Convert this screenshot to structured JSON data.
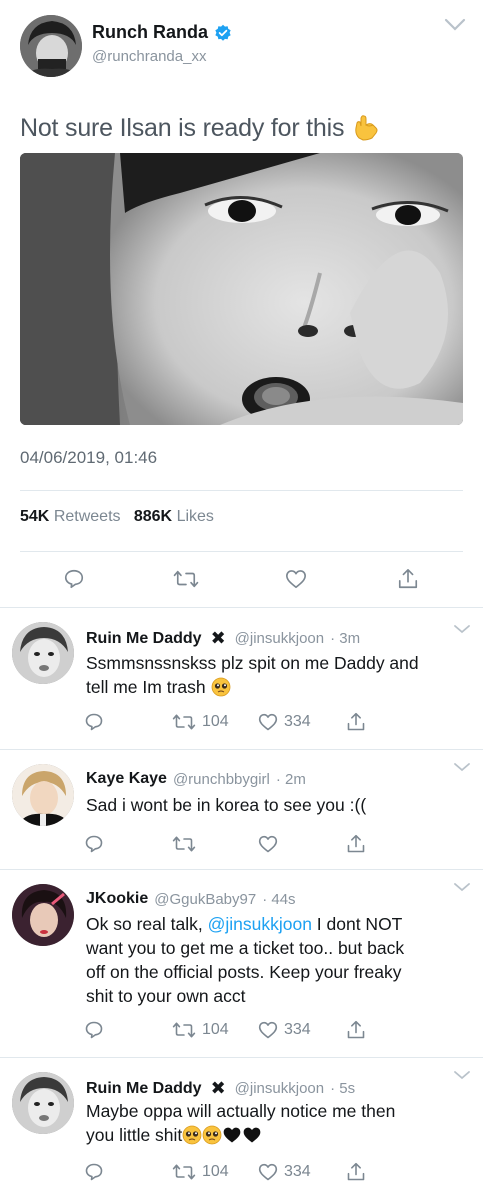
{
  "main_tweet": {
    "author_name": "Runch Randa",
    "handle": "@runchranda_xx",
    "verified": true,
    "text": "Not sure Ilsan is ready for this",
    "text_emoji": "hand-sign-emoji",
    "timestamp": "04/06/2019, 01:46",
    "retweets_count": "54K",
    "retweets_label": "Retweets",
    "likes_count": "886K",
    "likes_label": "Likes"
  },
  "replies": [
    {
      "name": "Ruin Me Daddy",
      "name_suffix": "✖",
      "handle": "@jinsukkjoon",
      "time": "· 3m",
      "text_line1": "Ssmmsnssnskss plz spit on me Daddy and",
      "text_line2": "tell me Im trash",
      "emojis": [
        "pleading-face-emoji"
      ],
      "retweets": "104",
      "likes": "334"
    },
    {
      "name": "Kaye Kaye",
      "handle": "@runchbbygirl",
      "time": "· 2m",
      "text": "Sad i wont be in korea to see you :((",
      "retweets": "",
      "likes": ""
    },
    {
      "name": "JKookie",
      "handle": "@GgukBaby97",
      "time": "· 44s",
      "text_line1_pre": "Ok so real talk, ",
      "mention": "@jinsukkjoon",
      "text_line1_post": " I dont NOT",
      "text_line2": "want you to get me a ticket too.. but back",
      "text_line3": "off on the official posts. Keep your freaky",
      "text_line4": "shit to your own acct",
      "retweets": "104",
      "likes": "334"
    },
    {
      "name": "Ruin Me Daddy",
      "name_suffix": "✖",
      "handle": "@jinsukkjoon",
      "time": "· 5s",
      "text_line1": "Maybe oppa will actually notice me then",
      "text_line2": "you little shit",
      "emojis": [
        "pleading-face-emoji",
        "pleading-face-emoji",
        "black-heart-emoji",
        "black-heart-emoji"
      ],
      "retweets": "104",
      "likes": "334"
    }
  ],
  "colors": {
    "text": "#14171a",
    "muted": "#8a949e",
    "mention": "#1da1f2",
    "verified": "#1da1f2",
    "divider": "#e1e8ed"
  }
}
